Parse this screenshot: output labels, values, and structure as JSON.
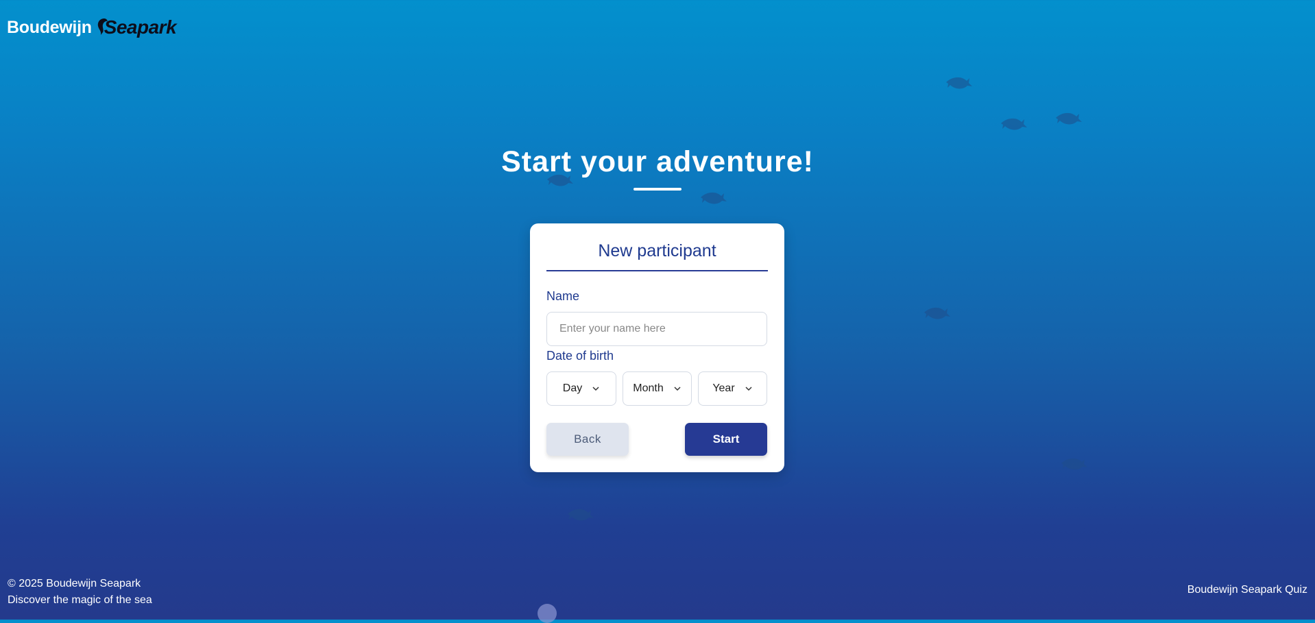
{
  "logo": {
    "word1": "Boudewijn",
    "word2": "Seapark"
  },
  "hero": {
    "title": "Start your adventure!"
  },
  "form": {
    "heading": "New participant",
    "name_label": "Name",
    "name_placeholder": "Enter your name here",
    "name_value": "",
    "dob_label": "Date of birth",
    "day": "Day",
    "month": "Month",
    "year": "Year",
    "back_label": "Back",
    "start_label": "Start"
  },
  "footer": {
    "copyright": "© 2025 Boudewijn Seapark",
    "tagline": "Discover the magic of the sea",
    "app_name": "Boudewijn Seapark Quiz"
  },
  "colors": {
    "primary": "#263a94",
    "bg_top": "#0390cd",
    "bg_bottom": "#243a8c",
    "back_button": "#dfe4ee"
  },
  "icons": [
    "dolphin-icon",
    "chevron-down-icon"
  ]
}
